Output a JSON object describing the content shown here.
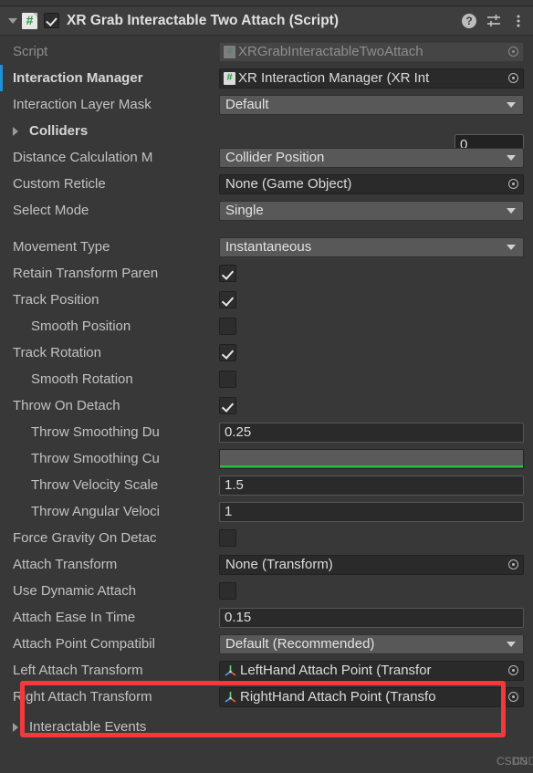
{
  "header": {
    "title": "XR Grab Interactable Two Attach (Script)",
    "enabled_checkbox": true,
    "script_icon": "csharp-script-icon",
    "foldout": "expanded",
    "icons": [
      {
        "name": "help-icon",
        "glyph": "?"
      },
      {
        "name": "preset-icon",
        "glyph": "sliders"
      },
      {
        "name": "more-menu-icon",
        "glyph": "kebab"
      }
    ]
  },
  "rows": [
    {
      "label": "Script",
      "type": "object",
      "value": "XRGrabInteractableTwoAttach",
      "icon": "csharp-script-icon",
      "disabled": true
    },
    {
      "label": "Interaction Manager",
      "type": "object",
      "value": "XR Interaction Manager (XR Int",
      "icon": "csharp-script-icon",
      "override": true,
      "bold": true
    },
    {
      "label": "Interaction Layer Mask",
      "type": "dropdown",
      "value": "Default"
    },
    {
      "label": "Colliders",
      "type": "array-size",
      "value": "0",
      "foldout": "collapsed",
      "bold": true
    },
    {
      "label": "Distance Calculation M",
      "type": "dropdown",
      "value": "Collider Position"
    },
    {
      "label": "Custom Reticle",
      "type": "object",
      "value": "None (Game Object)"
    },
    {
      "label": "Select Mode",
      "type": "dropdown",
      "value": "Single"
    },
    {
      "label": "Movement Type",
      "type": "dropdown",
      "value": "Instantaneous",
      "gap_above": true
    },
    {
      "label": "Retain Transform Paren",
      "type": "checkbox",
      "checked": true
    },
    {
      "label": "Track Position",
      "type": "checkbox",
      "checked": true
    },
    {
      "label": "Smooth Position",
      "type": "checkbox",
      "checked": false,
      "indent": 1
    },
    {
      "label": "Track Rotation",
      "type": "checkbox",
      "checked": true
    },
    {
      "label": "Smooth Rotation",
      "type": "checkbox",
      "checked": false,
      "indent": 1
    },
    {
      "label": "Throw On Detach",
      "type": "checkbox",
      "checked": true
    },
    {
      "label": "Throw Smoothing Du",
      "type": "text",
      "value": "0.25",
      "indent": 1
    },
    {
      "label": "Throw Smoothing Cu",
      "type": "curve",
      "value": "",
      "curve_color": "#2cbd36",
      "indent": 1
    },
    {
      "label": "Throw Velocity Scale",
      "type": "text",
      "value": "1.5",
      "indent": 1
    },
    {
      "label": "Throw Angular Veloci",
      "type": "text",
      "value": "1",
      "indent": 1
    },
    {
      "label": "Force Gravity On Detac",
      "type": "checkbox",
      "checked": false
    },
    {
      "label": "Attach Transform",
      "type": "object",
      "value": "None (Transform)"
    },
    {
      "label": "Use Dynamic Attach",
      "type": "checkbox",
      "checked": false
    },
    {
      "label": "Attach Ease In Time",
      "type": "text",
      "value": "0.15"
    },
    {
      "label": "Attach Point Compatibil",
      "type": "dropdown",
      "value": "Default (Recommended)"
    },
    {
      "label": "Left Attach Transform",
      "type": "object",
      "value": "LeftHand Attach Point (Transfor",
      "icon": "transform-icon",
      "highlighted": true
    },
    {
      "label": "Right Attach Transform",
      "type": "object",
      "value": "RightHand Attach Point (Transfo",
      "icon": "transform-icon",
      "highlighted": true
    }
  ],
  "footer": {
    "label": "Interactable Events",
    "foldout": "collapsed"
  },
  "highlight": {
    "color": "#f4383c",
    "name": "attach-transform-highlight"
  },
  "watermark": {
    "text_front": "CSDN",
    "text_back": "CSDN@极梦网络无忧"
  },
  "colors": {
    "background": "#383838",
    "header_background": "#3e3e3e",
    "dropdown": "#585858",
    "input": "#2a2a2a",
    "override_marker": "#1e90d8",
    "curve_green": "#2cbd36",
    "highlight_red": "#f4383c"
  }
}
